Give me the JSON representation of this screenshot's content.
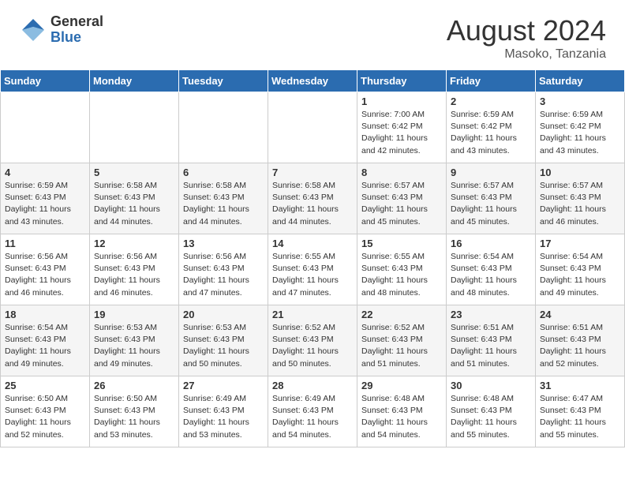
{
  "header": {
    "logo_general": "General",
    "logo_blue": "Blue",
    "month_year": "August 2024",
    "location": "Masoko, Tanzania"
  },
  "days_of_week": [
    "Sunday",
    "Monday",
    "Tuesday",
    "Wednesday",
    "Thursday",
    "Friday",
    "Saturday"
  ],
  "weeks": [
    [
      {
        "day": "",
        "content": ""
      },
      {
        "day": "",
        "content": ""
      },
      {
        "day": "",
        "content": ""
      },
      {
        "day": "",
        "content": ""
      },
      {
        "day": "1",
        "content": "Sunrise: 7:00 AM\nSunset: 6:42 PM\nDaylight: 11 hours\nand 42 minutes."
      },
      {
        "day": "2",
        "content": "Sunrise: 6:59 AM\nSunset: 6:42 PM\nDaylight: 11 hours\nand 43 minutes."
      },
      {
        "day": "3",
        "content": "Sunrise: 6:59 AM\nSunset: 6:42 PM\nDaylight: 11 hours\nand 43 minutes."
      }
    ],
    [
      {
        "day": "4",
        "content": "Sunrise: 6:59 AM\nSunset: 6:43 PM\nDaylight: 11 hours\nand 43 minutes."
      },
      {
        "day": "5",
        "content": "Sunrise: 6:58 AM\nSunset: 6:43 PM\nDaylight: 11 hours\nand 44 minutes."
      },
      {
        "day": "6",
        "content": "Sunrise: 6:58 AM\nSunset: 6:43 PM\nDaylight: 11 hours\nand 44 minutes."
      },
      {
        "day": "7",
        "content": "Sunrise: 6:58 AM\nSunset: 6:43 PM\nDaylight: 11 hours\nand 44 minutes."
      },
      {
        "day": "8",
        "content": "Sunrise: 6:57 AM\nSunset: 6:43 PM\nDaylight: 11 hours\nand 45 minutes."
      },
      {
        "day": "9",
        "content": "Sunrise: 6:57 AM\nSunset: 6:43 PM\nDaylight: 11 hours\nand 45 minutes."
      },
      {
        "day": "10",
        "content": "Sunrise: 6:57 AM\nSunset: 6:43 PM\nDaylight: 11 hours\nand 46 minutes."
      }
    ],
    [
      {
        "day": "11",
        "content": "Sunrise: 6:56 AM\nSunset: 6:43 PM\nDaylight: 11 hours\nand 46 minutes."
      },
      {
        "day": "12",
        "content": "Sunrise: 6:56 AM\nSunset: 6:43 PM\nDaylight: 11 hours\nand 46 minutes."
      },
      {
        "day": "13",
        "content": "Sunrise: 6:56 AM\nSunset: 6:43 PM\nDaylight: 11 hours\nand 47 minutes."
      },
      {
        "day": "14",
        "content": "Sunrise: 6:55 AM\nSunset: 6:43 PM\nDaylight: 11 hours\nand 47 minutes."
      },
      {
        "day": "15",
        "content": "Sunrise: 6:55 AM\nSunset: 6:43 PM\nDaylight: 11 hours\nand 48 minutes."
      },
      {
        "day": "16",
        "content": "Sunrise: 6:54 AM\nSunset: 6:43 PM\nDaylight: 11 hours\nand 48 minutes."
      },
      {
        "day": "17",
        "content": "Sunrise: 6:54 AM\nSunset: 6:43 PM\nDaylight: 11 hours\nand 49 minutes."
      }
    ],
    [
      {
        "day": "18",
        "content": "Sunrise: 6:54 AM\nSunset: 6:43 PM\nDaylight: 11 hours\nand 49 minutes."
      },
      {
        "day": "19",
        "content": "Sunrise: 6:53 AM\nSunset: 6:43 PM\nDaylight: 11 hours\nand 49 minutes."
      },
      {
        "day": "20",
        "content": "Sunrise: 6:53 AM\nSunset: 6:43 PM\nDaylight: 11 hours\nand 50 minutes."
      },
      {
        "day": "21",
        "content": "Sunrise: 6:52 AM\nSunset: 6:43 PM\nDaylight: 11 hours\nand 50 minutes."
      },
      {
        "day": "22",
        "content": "Sunrise: 6:52 AM\nSunset: 6:43 PM\nDaylight: 11 hours\nand 51 minutes."
      },
      {
        "day": "23",
        "content": "Sunrise: 6:51 AM\nSunset: 6:43 PM\nDaylight: 11 hours\nand 51 minutes."
      },
      {
        "day": "24",
        "content": "Sunrise: 6:51 AM\nSunset: 6:43 PM\nDaylight: 11 hours\nand 52 minutes."
      }
    ],
    [
      {
        "day": "25",
        "content": "Sunrise: 6:50 AM\nSunset: 6:43 PM\nDaylight: 11 hours\nand 52 minutes."
      },
      {
        "day": "26",
        "content": "Sunrise: 6:50 AM\nSunset: 6:43 PM\nDaylight: 11 hours\nand 53 minutes."
      },
      {
        "day": "27",
        "content": "Sunrise: 6:49 AM\nSunset: 6:43 PM\nDaylight: 11 hours\nand 53 minutes."
      },
      {
        "day": "28",
        "content": "Sunrise: 6:49 AM\nSunset: 6:43 PM\nDaylight: 11 hours\nand 54 minutes."
      },
      {
        "day": "29",
        "content": "Sunrise: 6:48 AM\nSunset: 6:43 PM\nDaylight: 11 hours\nand 54 minutes."
      },
      {
        "day": "30",
        "content": "Sunrise: 6:48 AM\nSunset: 6:43 PM\nDaylight: 11 hours\nand 55 minutes."
      },
      {
        "day": "31",
        "content": "Sunrise: 6:47 AM\nSunset: 6:43 PM\nDaylight: 11 hours\nand 55 minutes."
      }
    ]
  ]
}
